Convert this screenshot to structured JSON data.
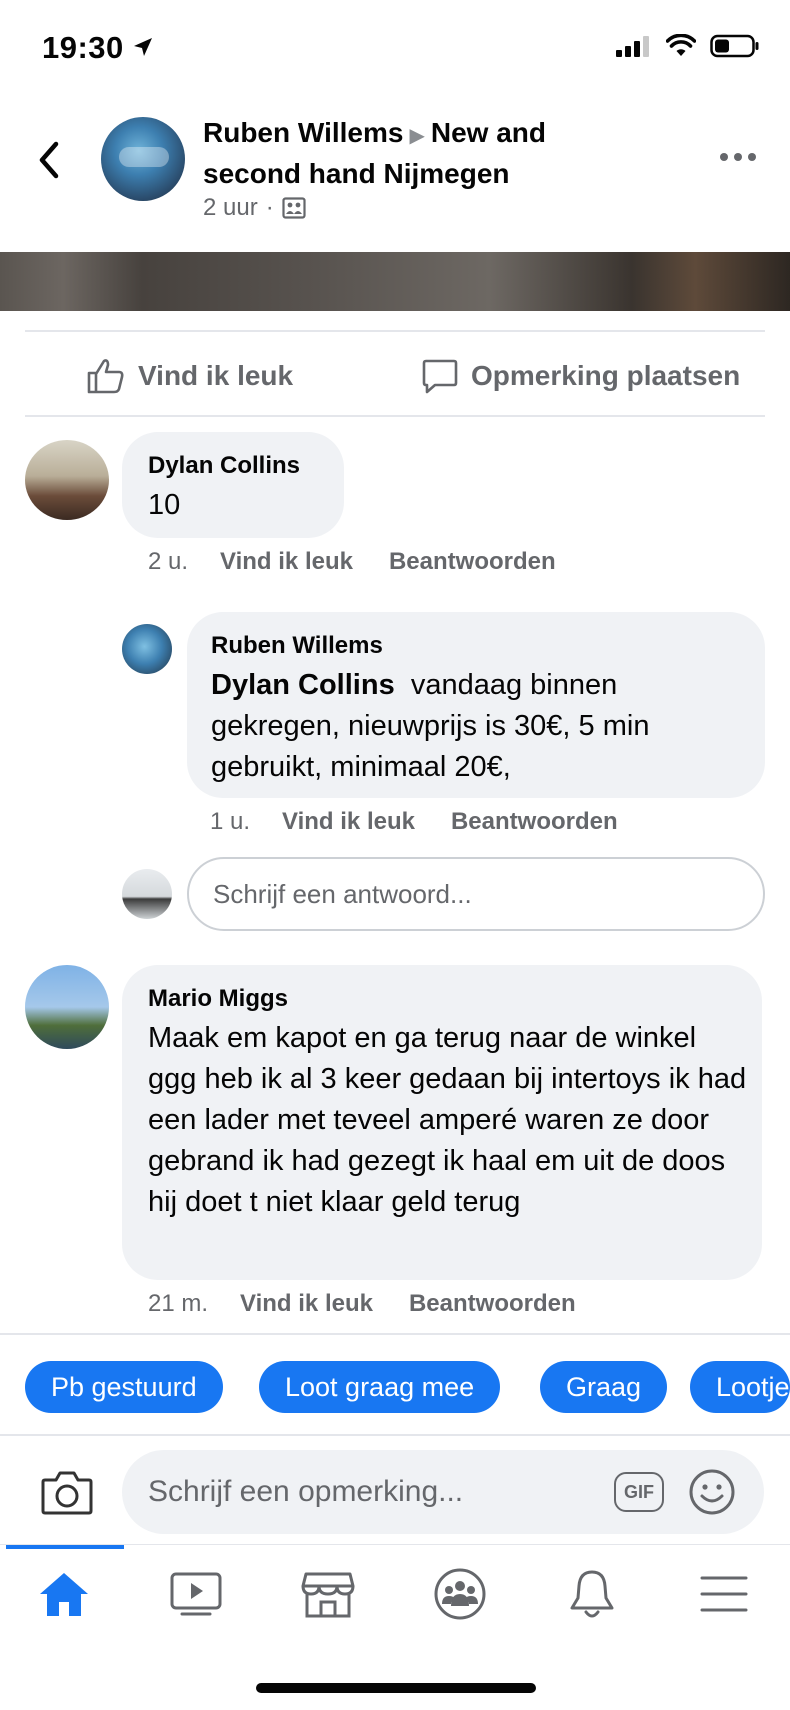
{
  "status_bar": {
    "time": "19:30"
  },
  "header": {
    "author": "Ruben Willems",
    "group": "New and second hand Nijmegen",
    "time": "2 uur",
    "separator": "·"
  },
  "actions": {
    "like": "Vind ik leuk",
    "comment": "Opmerking plaatsen"
  },
  "comments": [
    {
      "name": "Dylan Collins",
      "text": "10",
      "time": "2 u.",
      "like": "Vind ik leuk",
      "reply": "Beantwoorden"
    },
    {
      "name": "Ruben Willems",
      "mention": "Dylan Collins",
      "text": "vandaag binnen gekregen, nieuwprijs is 30€, 5 min gebruikt, minimaal 20€,",
      "time": "1 u.",
      "like": "Vind ik leuk",
      "reply": "Beantwoorden"
    },
    {
      "name": "Mario Miggs",
      "text": "Maak em kapot en ga terug naar de winkel ggg heb ik al 3 keer gedaan bij intertoys ik had een lader met teveel amperé waren ze door gebrand ik had gezegt ik haal em uit de doos hij doet t niet klaar geld terug",
      "time": "21 m.",
      "like": "Vind ik leuk",
      "reply": "Beantwoorden"
    }
  ],
  "reply_input": {
    "placeholder": "Schrijf een antwoord..."
  },
  "quick_replies": [
    "Pb gestuurd",
    "Loot graag mee",
    "Graag",
    "Lootje"
  ],
  "composer": {
    "placeholder": "Schrijf een opmerking...",
    "gif_label": "GIF"
  },
  "tabs": [
    "home-icon",
    "video-icon",
    "marketplace-icon",
    "groups-icon",
    "notifications-icon",
    "menu-icon"
  ],
  "colors": {
    "accent": "#1877f2",
    "secondary_text": "#65676b",
    "bubble": "#f0f2f5"
  }
}
